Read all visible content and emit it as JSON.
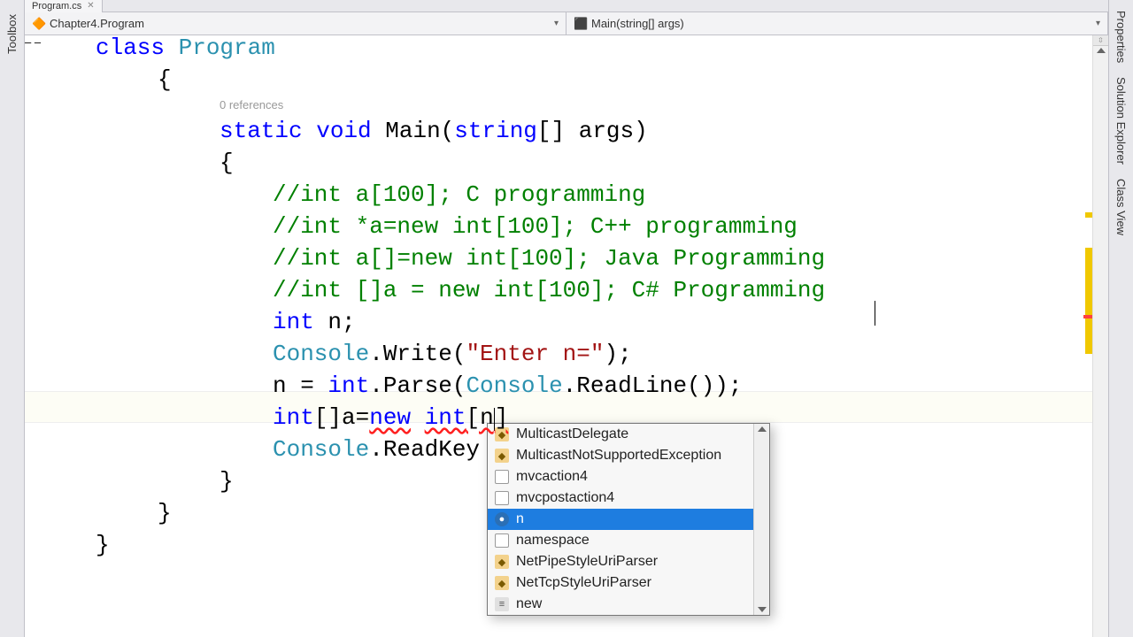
{
  "tabs": {
    "file_name": "Program.cs"
  },
  "nav": {
    "left_label": "Chapter4.Program",
    "right_label": "Main(string[] args)"
  },
  "sidepanels": {
    "left": [
      "Toolbox"
    ],
    "right": [
      "Properties",
      "Solution Explorer",
      "Class View"
    ]
  },
  "codelens": {
    "references": "0 references"
  },
  "code": {
    "l0a": "class",
    "l0b": " ",
    "l0c": "Program",
    "l1": "{",
    "l3a": "static",
    "l3b": " ",
    "l3c": "void",
    "l3d": " Main(",
    "l3e": "string",
    "l3f": "[] args)",
    "l4": "{",
    "l5": "//int a[100]; C programming",
    "l6": "//int *a=new int[100]; C++ programming",
    "l7": "//int a[]=new int[100]; Java Programming",
    "l8": "//int []a = new int[100]; C# Programming",
    "l9a": "int",
    "l9b": " n;",
    "l10a": "Console",
    "l10b": ".Write(",
    "l10c": "\"Enter n=\"",
    "l10d": ");",
    "l11a": "n = ",
    "l11b": "int",
    "l11c": ".Parse(",
    "l11d": "Console",
    "l11e": ".ReadLine());",
    "l12a": "int",
    "l12b": "[]a=",
    "l12c": "new",
    "l12d": " ",
    "l12e": "int",
    "l12f": "[n",
    "l12g": "]",
    "l13": "",
    "l14a": "Console",
    "l14b": ".ReadKey",
    "l15": "}",
    "l16": "}",
    "l17": "}"
  },
  "intellisense": {
    "items": [
      {
        "label": "MulticastDelegate",
        "kind": "delegate"
      },
      {
        "label": "MulticastNotSupportedException",
        "kind": "delegate"
      },
      {
        "label": "mvcaction4",
        "kind": "snippet"
      },
      {
        "label": "mvcpostaction4",
        "kind": "snippet"
      },
      {
        "label": "n",
        "kind": "var",
        "selected": true
      },
      {
        "label": "namespace",
        "kind": "snippet"
      },
      {
        "label": "NetPipeStyleUriParser",
        "kind": "delegate"
      },
      {
        "label": "NetTcpStyleUriParser",
        "kind": "delegate"
      },
      {
        "label": "new",
        "kind": "keyword"
      }
    ]
  },
  "colors": {
    "keyword": "#0000ff",
    "class_name": "#2b91af",
    "string": "#a31515",
    "comment": "#008000",
    "selection": "#1e7de0"
  }
}
